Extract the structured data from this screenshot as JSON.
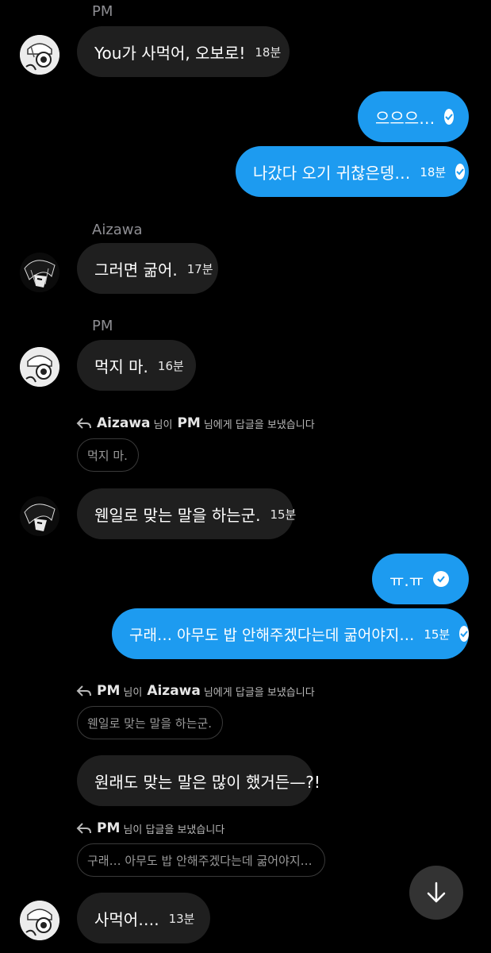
{
  "messages": [
    {
      "sender": "PM",
      "text": "You가 사먹어, 오보로!",
      "time": "18분"
    },
    {
      "text": "으으으…",
      "time": ""
    },
    {
      "text": "나갔다 오기 귀찮은뎅…",
      "time": "18분"
    },
    {
      "sender": "Aizawa",
      "text": "그러면 굶어.",
      "time": "17분"
    },
    {
      "sender": "PM",
      "text": "먹지 마.",
      "time": "16분"
    },
    {
      "reply": {
        "from": "Aizawa",
        "to": "PM",
        "gap1": "님이",
        "gap2": "님에게 답글을 보냈습니다",
        "quote": "먹지 마."
      },
      "text": "웬일로 맞는 말을 하는군.",
      "time": "15분"
    },
    {
      "text": "ㅠ.ㅠ",
      "time": ""
    },
    {
      "text": "구래… 아무도 밥 안해주겠다는데 굶어야지…",
      "time": "15분"
    },
    {
      "reply": {
        "from": "PM",
        "to": "Aizawa",
        "gap1": "님이",
        "gap2": "님에게 답글을 보냈습니다",
        "quote": "웬일로 맞는 말을 하는군."
      },
      "text": "원래도 맞는 말은 많이 했거든—?!",
      "time": ""
    },
    {
      "reply": {
        "from": "PM",
        "text": "님이 답글을 보냈습니다",
        "quote": "구래… 아무도 밥 안해주겠다는데 굶어야지…"
      },
      "text": "사먹어…. ",
      "time": "13분"
    }
  ],
  "icons": {
    "reply": "reply-arrow-icon",
    "read": "check-circle-icon",
    "scroll": "arrow-down-icon"
  },
  "colors": {
    "outgoing": "#1d9bf0",
    "incoming": "#1f1f1f",
    "background": "#000000"
  }
}
